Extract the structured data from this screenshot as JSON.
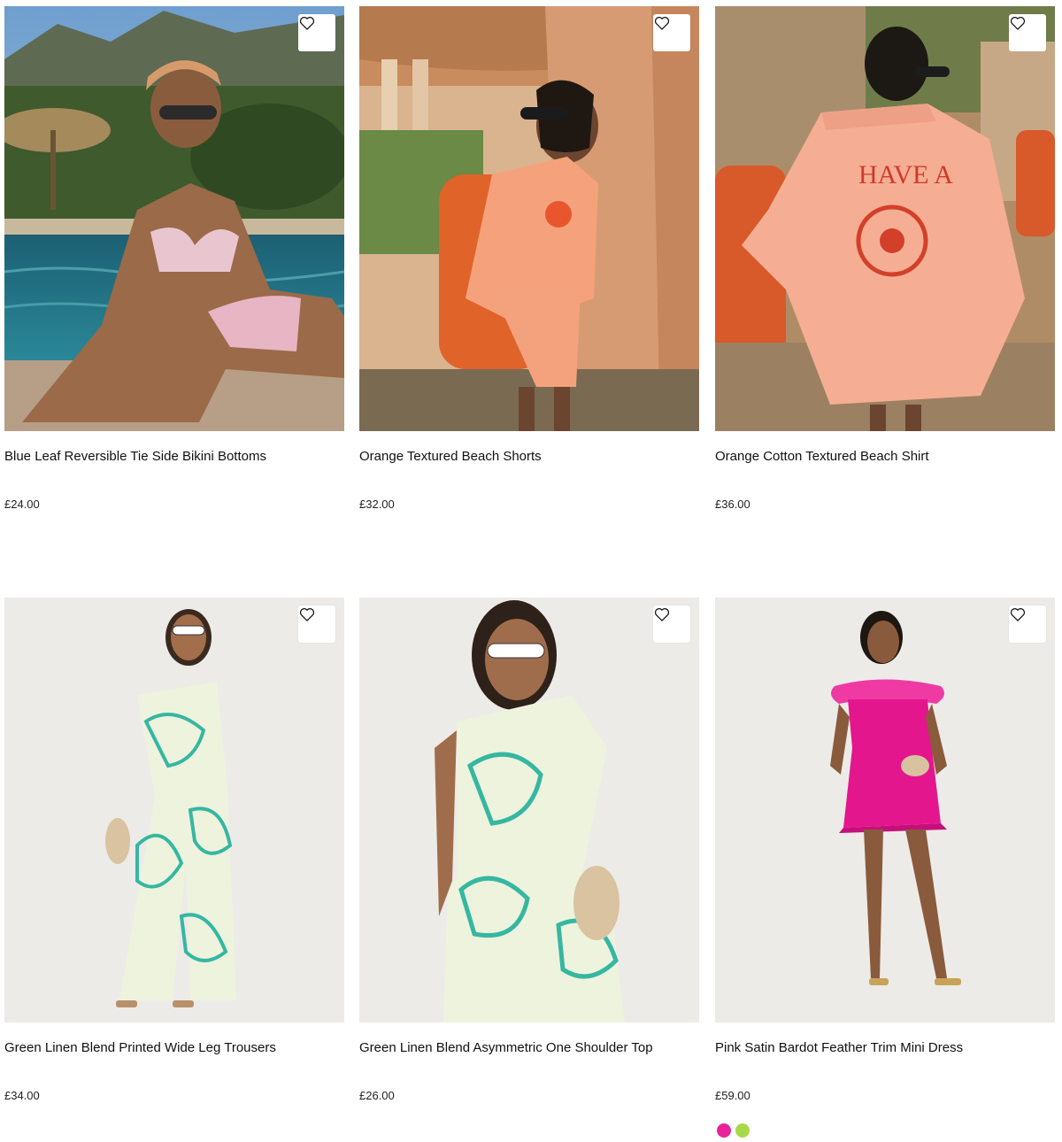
{
  "products": [
    {
      "title": "Blue Leaf Reversible Tie Side Bikini Bottoms",
      "price": "£24.00",
      "wishlist_icon": "heart-outline-icon",
      "image_alt": "Model in floral bikini by a pool"
    },
    {
      "title": "Orange Textured Beach Shorts",
      "price": "£32.00",
      "wishlist_icon": "heart-outline-icon",
      "image_alt": "Model in orange beach shirt and shorts"
    },
    {
      "title": "Orange Cotton Textured Beach Shirt",
      "price": "£36.00",
      "wishlist_icon": "heart-outline-icon",
      "image_alt": "Model in orange beach shirt with embroidered back"
    },
    {
      "title": "Green Linen Blend Printed Wide Leg Trousers",
      "price": "£34.00",
      "wishlist_icon": "heart-outline-icon",
      "image_alt": "Model in green printed top and wide leg trousers"
    },
    {
      "title": "Green Linen Blend Asymmetric One Shoulder Top",
      "price": "£26.00",
      "wishlist_icon": "heart-outline-icon",
      "image_alt": "Model in green printed one shoulder top"
    },
    {
      "title": "Pink Satin Bardot Feather Trim Mini Dress",
      "price": "£59.00",
      "wishlist_icon": "heart-outline-icon",
      "image_alt": "Model in pink satin bardot mini dress",
      "swatches": [
        "#e8239a",
        "#a9d84a"
      ]
    }
  ],
  "colors": {
    "text": "#111111",
    "wishlist_bg": "#ffffff"
  }
}
